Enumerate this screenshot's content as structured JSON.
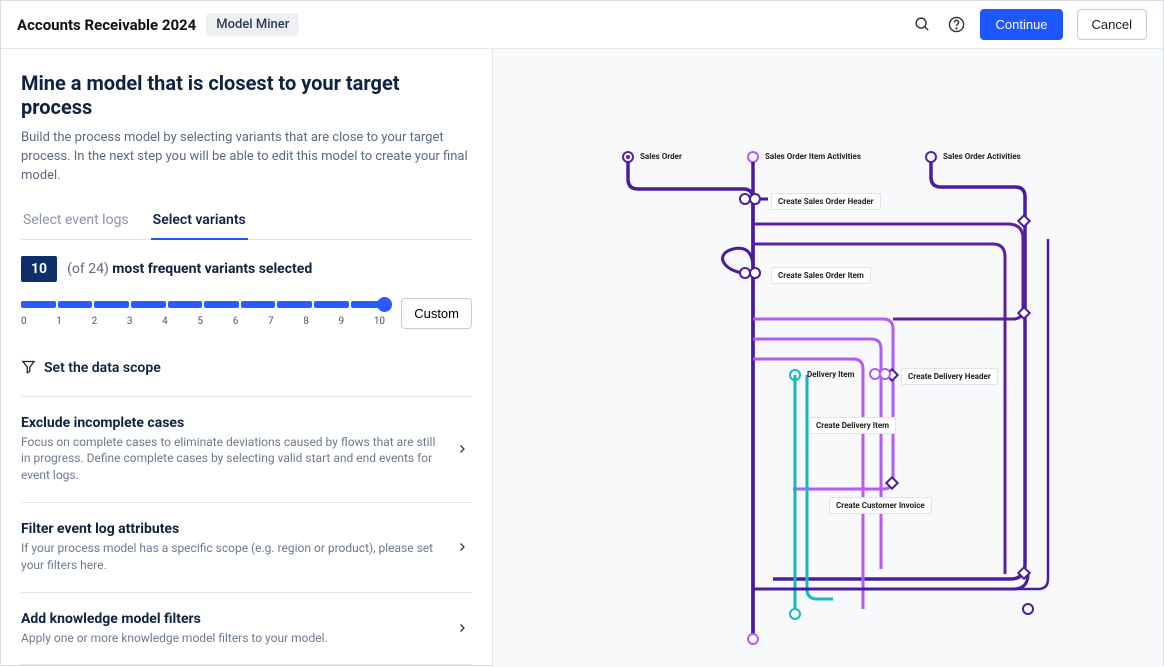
{
  "header": {
    "title": "Accounts Receivable 2024",
    "chip": "Model Miner",
    "continue": "Continue",
    "cancel": "Cancel"
  },
  "page": {
    "title": "Mine a model that is closest to your target process",
    "desc": "Build the process model by selecting variants that are close to your target process. In the next step you will be able to edit this model to create your final model."
  },
  "tabs": {
    "event_logs": "Select event logs",
    "variants": "Select variants"
  },
  "variants": {
    "count": "10",
    "of": "(of 24)",
    "label": "most frequent variants selected",
    "custom": "Custom",
    "ticks": [
      "0",
      "1",
      "2",
      "3",
      "4",
      "5",
      "6",
      "7",
      "8",
      "9",
      "10"
    ]
  },
  "scope": {
    "header": "Set the data scope",
    "items": [
      {
        "title": "Exclude incomplete cases",
        "desc": "Focus on complete cases to eliminate deviations caused by flows that are still in progress. Define complete cases by selecting valid start and end events for event logs."
      },
      {
        "title": "Filter event log attributes",
        "desc": "If your process model has a specific scope (e.g. region or product), please set your filters here."
      },
      {
        "title": "Add knowledge model filters",
        "desc": "Apply one or more knowledge model filters to your model."
      }
    ]
  },
  "diagram": {
    "nodes": {
      "sales_order": "Sales Order",
      "so_item_activities": "Sales Order Item Activities",
      "so_activities": "Sales Order Activities",
      "create_so_header": "Create Sales Order Header",
      "create_so_item": "Create Sales Order Item",
      "delivery_item": "Delivery Item",
      "create_delivery_header": "Create Delivery Header",
      "create_delivery_item": "Create Delivery Item",
      "create_customer_invoice": "Create Customer Invoice"
    }
  }
}
